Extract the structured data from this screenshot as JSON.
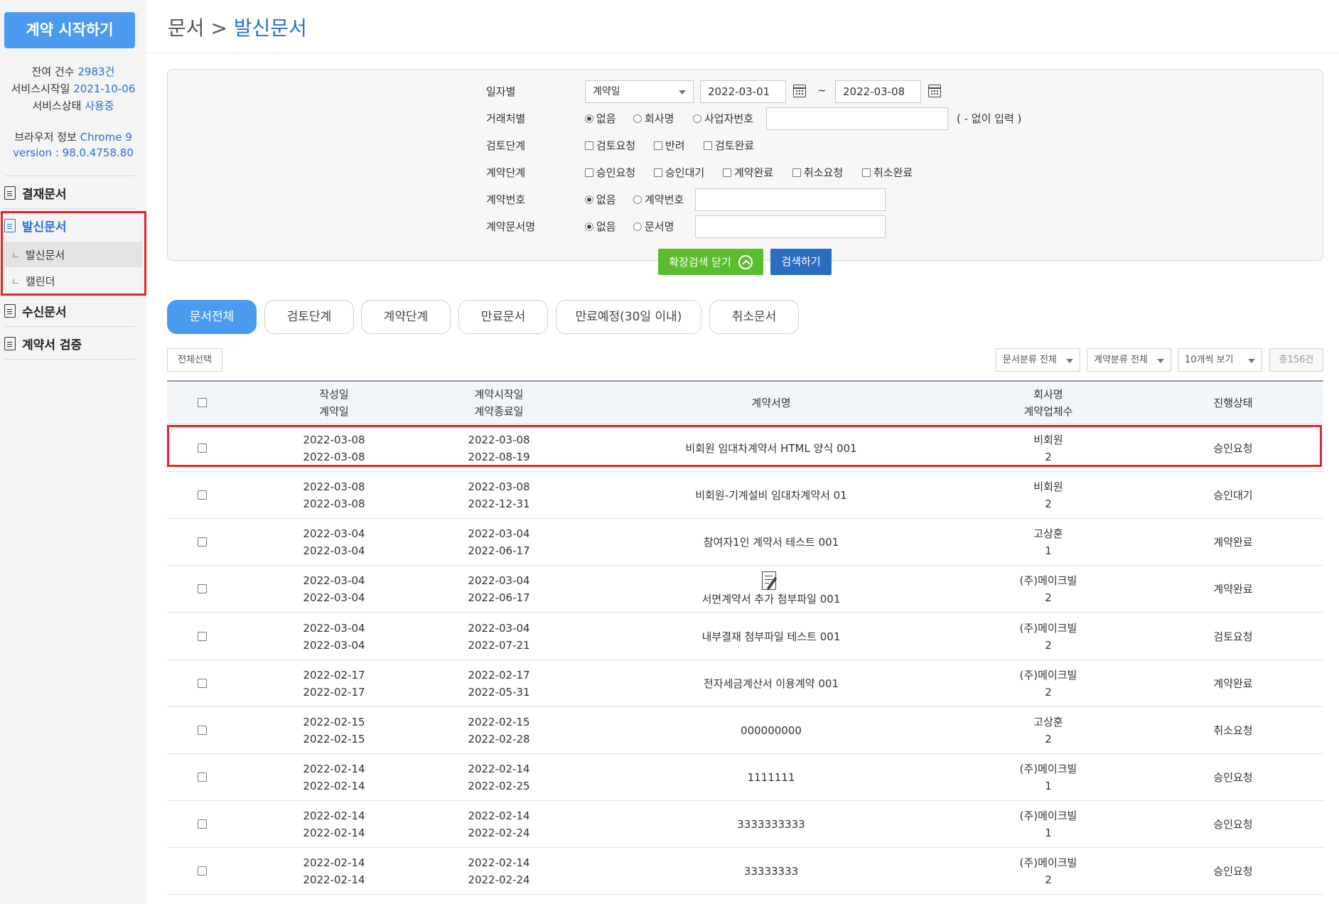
{
  "sidebar": {
    "start_button": "계약 시작하기",
    "remaining_label": "잔여 건수",
    "remaining_value": "2983건",
    "service_start_label": "서비스시작일",
    "service_start_value": "2021-10-06",
    "service_status_label": "서비스상태",
    "service_status_value": "사용중",
    "browser_label": "브라우저 정보",
    "browser_value": "Chrome 9",
    "version_label": "version :",
    "version_value": "98.0.4758.80",
    "menu": [
      "결재문서",
      "발신문서",
      "수신문서",
      "계약서 검증"
    ],
    "submenu": [
      "발신문서",
      "캘린더"
    ],
    "sub_prefix": "ㄴ"
  },
  "header": {
    "breadcrumb_root": "문서",
    "breadcrumb_sep": ">",
    "breadcrumb_current": "발신문서"
  },
  "search": {
    "labels": [
      "일자별",
      "거래처별",
      "검토단계",
      "계약단계",
      "계약번호",
      "계약문서명"
    ],
    "date_type": "계약일",
    "date_from": "2022-03-01",
    "date_to": "2022-03-08",
    "tilde": "~",
    "partner_options": [
      "없음",
      "회사명",
      "사업자번호"
    ],
    "partner_hint": "( - 없이 입력 )",
    "review_options": [
      "검토요청",
      "반려",
      "검토완료"
    ],
    "contract_options": [
      "승인요청",
      "승인대기",
      "계약완료",
      "취소요청",
      "취소완료"
    ],
    "number_options": [
      "없음",
      "계약번호"
    ],
    "docname_options": [
      "없음",
      "문서명"
    ],
    "collapse_button": "확장검색 닫기",
    "search_button": "검색하기"
  },
  "tabs": [
    "문서전체",
    "검토단계",
    "계약단계",
    "만료문서",
    "만료예정(30일 이내)",
    "취소문서"
  ],
  "toolbar": {
    "select_all": "전체선택",
    "doc_category": "문서분류 전체",
    "contract_category": "계약분류 전체",
    "page_size": "10개씩 보기",
    "total": "총156건"
  },
  "table": {
    "headers": {
      "created": "작성일",
      "contract_date": "계약일",
      "start": "계약시작일",
      "end": "계약종료일",
      "name": "계약서명",
      "company": "회사명",
      "parties": "계약업체수",
      "status": "진행상태"
    },
    "rows": [
      {
        "created": "2022-03-08",
        "contract_date": "2022-03-08",
        "start": "2022-03-08",
        "end": "2022-08-19",
        "name": "비회원 임대차계약서 HTML 양식 001",
        "company": "비회원",
        "parties": "2",
        "status": "승인요청"
      },
      {
        "created": "2022-03-08",
        "contract_date": "2022-03-08",
        "start": "2022-03-08",
        "end": "2022-12-31",
        "name": "비회원-기계설비 임대차계약서 01",
        "company": "비회원",
        "parties": "2",
        "status": "승인대기"
      },
      {
        "created": "2022-03-04",
        "contract_date": "2022-03-04",
        "start": "2022-03-04",
        "end": "2022-06-17",
        "name": "참여자1인 계약서 테스트 001",
        "company": "고상훈",
        "parties": "1",
        "status": "계약완료"
      },
      {
        "created": "2022-03-04",
        "contract_date": "2022-03-04",
        "start": "2022-03-04",
        "end": "2022-06-17",
        "name": "서면계약서 추가 첨부파일 001",
        "company": "(주)메이크빌",
        "parties": "2",
        "status": "계약완료",
        "icon": "document-edit-icon"
      },
      {
        "created": "2022-03-04",
        "contract_date": "2022-03-04",
        "start": "2022-03-04",
        "end": "2022-07-21",
        "name": "내부결재 첨부파일 테스트 001",
        "company": "(주)메이크빌",
        "parties": "2",
        "status": "검토요청"
      },
      {
        "created": "2022-02-17",
        "contract_date": "2022-02-17",
        "start": "2022-02-17",
        "end": "2022-05-31",
        "name": "전자세금계산서 이용계약 001",
        "company": "(주)메이크빌",
        "parties": "2",
        "status": "계약완료"
      },
      {
        "created": "2022-02-15",
        "contract_date": "2022-02-15",
        "start": "2022-02-15",
        "end": "2022-02-28",
        "name": "000000000",
        "company": "고상훈",
        "parties": "2",
        "status": "취소요청"
      },
      {
        "created": "2022-02-14",
        "contract_date": "2022-02-14",
        "start": "2022-02-14",
        "end": "2022-02-25",
        "name": "1111111",
        "company": "(주)메이크빌",
        "parties": "1",
        "status": "승인요청"
      },
      {
        "created": "2022-02-14",
        "contract_date": "2022-02-14",
        "start": "2022-02-14",
        "end": "2022-02-24",
        "name": "3333333333",
        "company": "(주)메이크빌",
        "parties": "1",
        "status": "승인요청"
      },
      {
        "created": "2022-02-14",
        "contract_date": "2022-02-14",
        "start": "2022-02-14",
        "end": "2022-02-24",
        "name": "33333333",
        "company": "(주)메이크빌",
        "parties": "2",
        "status": "승인요청"
      }
    ]
  },
  "colors": {
    "primary": "#4b9cf0",
    "link": "#2a6fcf",
    "highlight": "#e0262e",
    "green_button": "#5bbd2e",
    "blue_button": "#2b6dbf"
  }
}
